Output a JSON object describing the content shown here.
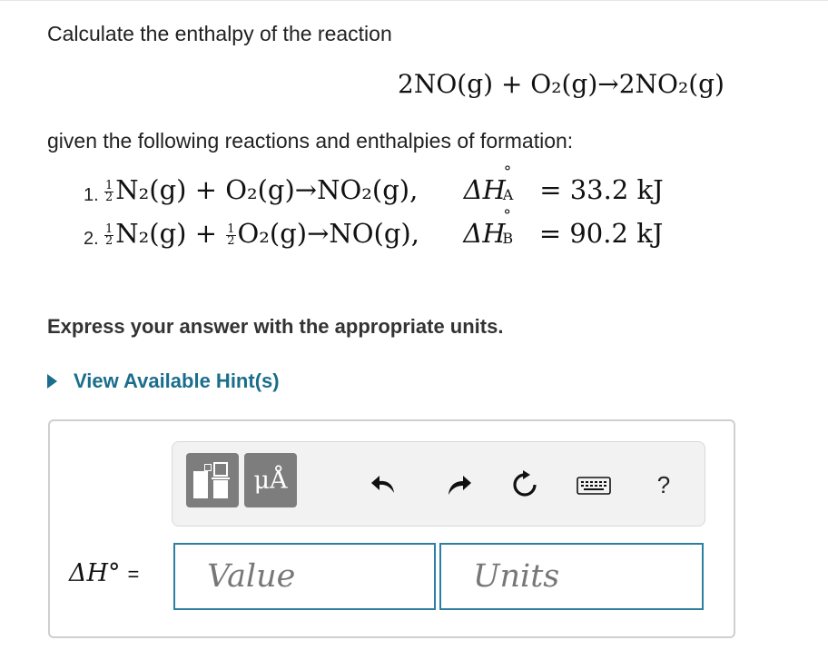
{
  "question": {
    "intro": "Calculate the enthalpy of the reaction",
    "target_reaction": "2NO(g) + O₂(g)→2NO₂(g)",
    "given_label": "given the following reactions and enthalpies of formation:",
    "reactions": [
      {
        "number": "1.",
        "frac_num": "1",
        "frac_den": "2",
        "equation": "N₂(g) + O₂(g)→NO₂(g),",
        "delta_symbol": "ΔH",
        "degree": "°",
        "label": "A",
        "value": "= 33.2 kJ"
      },
      {
        "number": "2.",
        "frac_num": "1",
        "frac_den": "2",
        "equation_part1": "N₂(g) +",
        "frac2_num": "1",
        "frac2_den": "2",
        "equation_part2": "O₂(g)→NO(g),",
        "delta_symbol": "ΔH",
        "degree": "°",
        "label": "B",
        "value": "= 90.2 kJ"
      }
    ],
    "instruction": "Express your answer with the appropriate units.",
    "hint_link": "View Available Hint(s)"
  },
  "answer": {
    "toolbar": {
      "units_button_label": "μÅ",
      "help_label": "?",
      "icons": [
        "templates-icon",
        "units-icon",
        "undo-icon",
        "redo-icon",
        "reset-icon",
        "keyboard-icon",
        "help-icon"
      ]
    },
    "label_symbol": "ΔH°",
    "label_equals": "=",
    "value_placeholder": "Value",
    "units_placeholder": "Units"
  },
  "colors": {
    "link": "#1a6e8c",
    "input_border": "#2c7fa0",
    "toolbar_button": "#7d7d7d"
  }
}
